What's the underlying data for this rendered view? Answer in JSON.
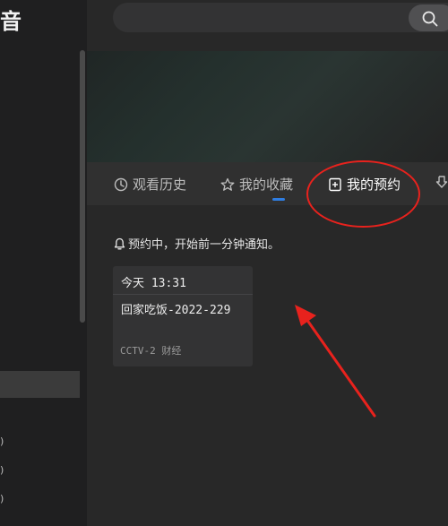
{
  "app": {
    "title": "音"
  },
  "sidebar": {
    "marks": [
      ")",
      ")",
      ")"
    ]
  },
  "tabs": [
    {
      "label": "观看历史",
      "icon": "clock-icon"
    },
    {
      "label": "我的收藏",
      "icon": "star-icon"
    },
    {
      "label": "我的预约",
      "icon": "reservation-icon",
      "active": true
    },
    {
      "label": "",
      "icon": "download-icon"
    }
  ],
  "reservations": {
    "notice": "预约中，开始前一分钟通知。",
    "notice_icon": "bell-icon",
    "items": [
      {
        "time": "今天 13:31",
        "title": "回家吃饭-2022-229",
        "channel": "CCTV-2 财经"
      }
    ]
  },
  "colors": {
    "accent": "#2f7de1",
    "annotation": "#e8221d"
  }
}
